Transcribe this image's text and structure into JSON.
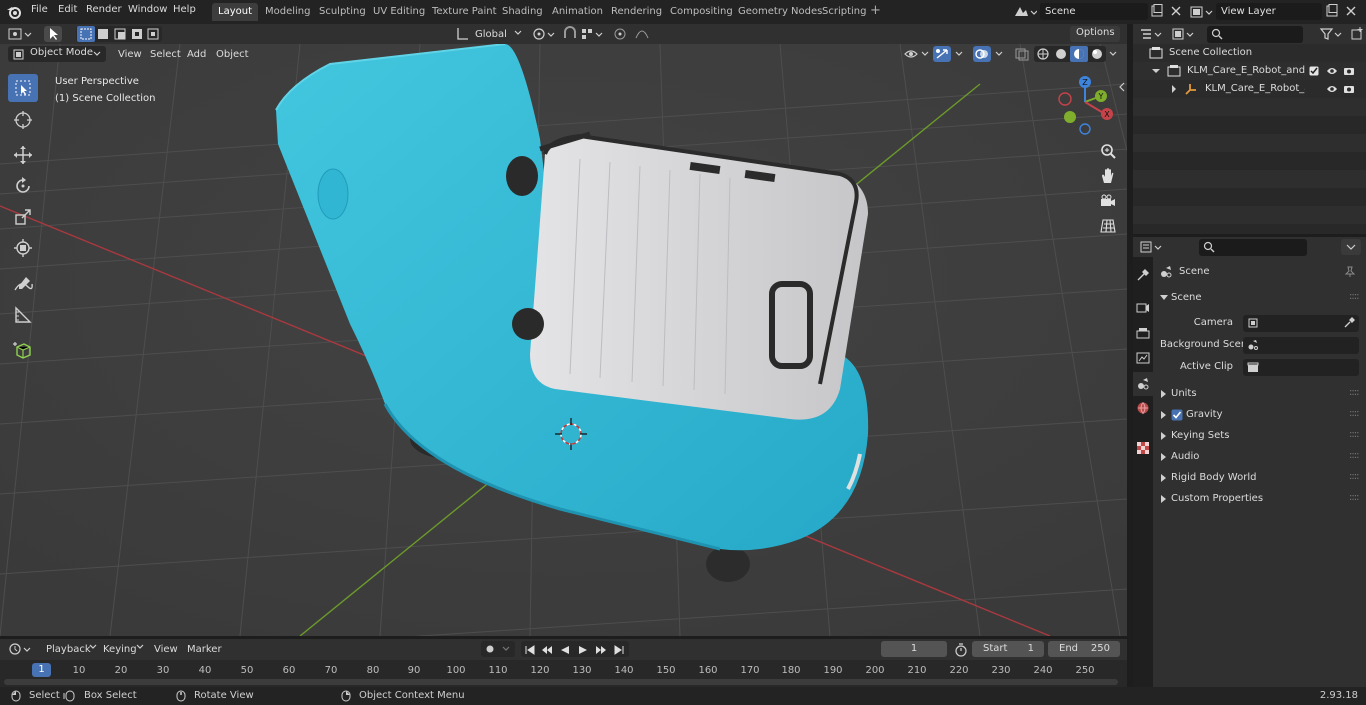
{
  "menu": {
    "file": "File",
    "edit": "Edit",
    "render": "Render",
    "window": "Window",
    "help": "Help"
  },
  "workspaces": [
    "Layout",
    "Modeling",
    "Sculpting",
    "UV Editing",
    "Texture Paint",
    "Shading",
    "Animation",
    "Rendering",
    "Compositing",
    "Geometry Nodes",
    "Scripting"
  ],
  "active_workspace": "Layout",
  "scene_name": "Scene",
  "view_layer": "View Layer",
  "viewport": {
    "mode": "Object Mode",
    "menu": {
      "view": "View",
      "select": "Select",
      "add": "Add",
      "object": "Object"
    },
    "transform_orientation": "Global",
    "options_label": "Options",
    "overlay_title": "User Perspective",
    "overlay_subtitle": "(1) Scene Collection"
  },
  "outliner": {
    "root": "Scene Collection",
    "items": [
      {
        "label": "KLM_Care_E_Robot_and_Whit"
      },
      {
        "label": "KLM_Care_E_Robot_and_"
      }
    ]
  },
  "properties": {
    "context": "Scene",
    "panel": "Scene",
    "camera_label": "Camera",
    "background_scene_label": "Background Scene",
    "active_clip_label": "Active Clip",
    "sections": [
      "Units",
      "Gravity",
      "Keying Sets",
      "Audio",
      "Rigid Body World",
      "Custom Properties"
    ]
  },
  "timeline": {
    "menu": {
      "playback": "Playback",
      "keying": "Keying",
      "view": "View",
      "marker": "Marker"
    },
    "current_frame": "1",
    "start_label": "Start",
    "start": "1",
    "end_label": "End",
    "end": "250",
    "ticks": [
      "10",
      "20",
      "30",
      "40",
      "50",
      "60",
      "70",
      "80",
      "90",
      "100",
      "110",
      "120",
      "130",
      "140",
      "150",
      "160",
      "170",
      "180",
      "190",
      "200",
      "210",
      "220",
      "230",
      "240",
      "250"
    ],
    "playhead": "1"
  },
  "statusbar": {
    "select": "Select",
    "box_select": "Box Select",
    "rotate_view": "Rotate View",
    "context_menu": "Object Context Menu",
    "version": "2.93.18"
  },
  "colors": {
    "accent": "#4772b3",
    "robot": "#35bcd8",
    "suitcase": "#d2d2d4",
    "x_axis": "#c6434a",
    "y_axis": "#7fae2c",
    "z_axis": "#3e84dc"
  }
}
